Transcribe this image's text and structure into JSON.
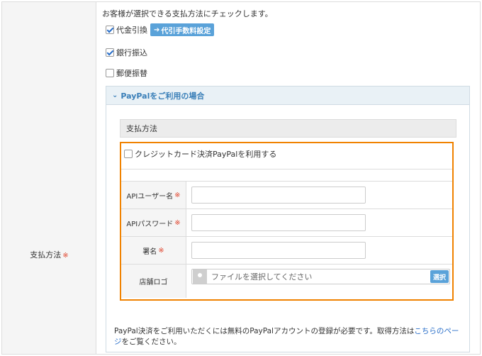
{
  "left_label": "支払方法",
  "required_mark": "※",
  "intro": "お客様が選択できる支払方法にチェックします。",
  "options": [
    {
      "label": "代金引換",
      "checked": true
    },
    {
      "label": "銀行振込",
      "checked": true
    },
    {
      "label": "郵便振替",
      "checked": false
    }
  ],
  "fee_button": "代引手数料設定",
  "paypal": {
    "section_title": "PayPalをご利用の場合",
    "payment_method_title": "支払方法",
    "use_label": "クレジットカード決済PayPalを利用する",
    "use_checked": false,
    "fields": [
      {
        "label": "APIユーザー名",
        "required": true,
        "value": ""
      },
      {
        "label": "APIパスワード",
        "required": true,
        "value": ""
      },
      {
        "label": "署名",
        "required": true,
        "value": ""
      }
    ],
    "logo_label": "店舗ロゴ",
    "file_placeholder": "ファイルを選択してください",
    "select_button": "選択",
    "note_before": "PayPal決済をご利用いただくには無料のPayPalアカウントの登録が必要です。取得方法は",
    "note_link": "こちらのページ",
    "note_after": "をご覧ください。"
  },
  "colors": {
    "accent": "#5aa2d9",
    "highlight": "#f08200",
    "required": "#e0452e",
    "link": "#2a6fc9"
  }
}
